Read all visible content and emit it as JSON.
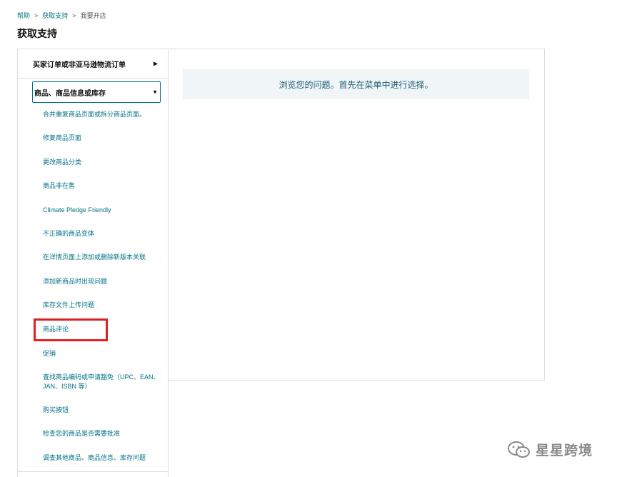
{
  "breadcrumb": {
    "items": [
      "帮助",
      "获取支持",
      "我要开店"
    ],
    "separator": ">"
  },
  "page_title": "获取支持",
  "sidebar": {
    "categories": [
      {
        "label": "买家订单或非亚马逊物流订单",
        "expanded": false
      },
      {
        "label": "商品、商品信息或库存",
        "expanded": true
      }
    ],
    "collapsed_arrow": "▶",
    "expanded_arrow": "▼",
    "sub_items": [
      "合并重复商品页面或拆分商品页面。",
      "修复商品页面",
      "更改商品分类",
      "商品非在售",
      "Climate Pledge Friendly",
      "不正确的商品变体",
      "在详情页面上添加或删除新版本关联",
      "添加新商品时出现问题",
      "库存文件上传问题",
      "商品评论",
      "促销",
      "查找商品编码或申请豁免（UPC、EAN、JAN、ISBN 等）",
      "购买按钮",
      "检查您的商品是否需要批准",
      "调查其他商品、商品信息、库存问题"
    ],
    "highlighted_item": "商品评论"
  },
  "main": {
    "prompt": "浏览您的问题。首先在菜单中进行选择。"
  },
  "watermark": {
    "text": "星星跨境",
    "icon": "wechat-icon"
  },
  "colors": {
    "link": "#007185",
    "highlight_border": "#e02020",
    "prompt_bg": "#f0f5f7",
    "border": "#dddddd"
  }
}
